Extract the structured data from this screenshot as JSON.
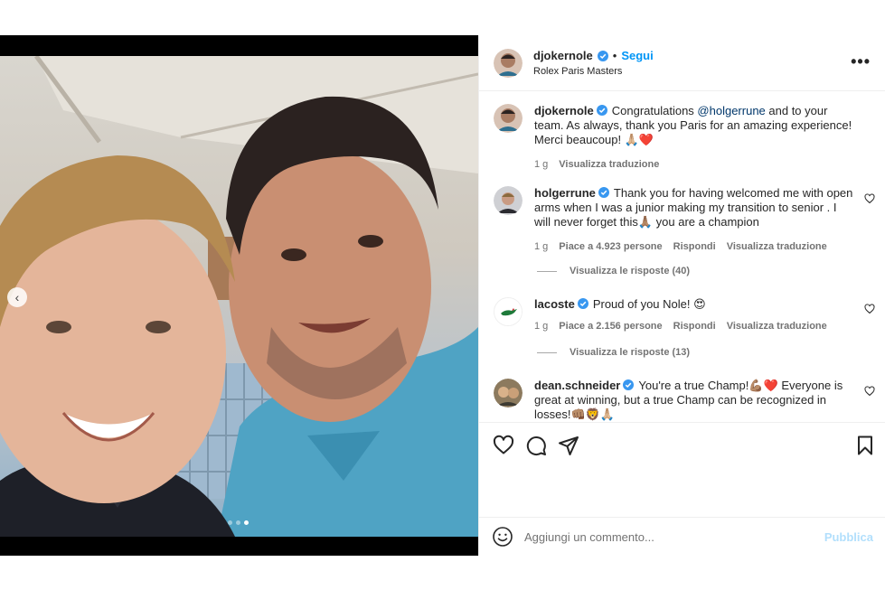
{
  "post": {
    "author": "djokernole",
    "bullet": "•",
    "follow_label": "Segui",
    "location": "Rolex Paris Masters",
    "more_label": "•••",
    "carousel": {
      "total": 3,
      "active_index": 2
    }
  },
  "comments": [
    {
      "user": "djokernole",
      "verified": true,
      "text_before": "Congratulations ",
      "mention": "@holgerrune",
      "text_after": " and to your team. As always, thank you Paris for an amazing experience! Merci beaucoup! 🙏🏼❤️",
      "time": "1 g",
      "translate": "Visualizza traduzione"
    },
    {
      "user": "holgerrune",
      "verified": true,
      "text": "Thank you for having welcomed me with open arms when I was a junior making my transition to senior . I will never forget this🙏🏽 you are a champion",
      "time": "1 g",
      "likes": "Piace a 4.923 persone",
      "reply": "Rispondi",
      "translate": "Visualizza traduzione",
      "replies_label": "Visualizza le risposte (40)"
    },
    {
      "user": "lacoste",
      "verified": true,
      "text": "Proud of you Nole! 😍",
      "time": "1 g",
      "likes": "Piace a 2.156 persone",
      "reply": "Rispondi",
      "translate": "Visualizza traduzione",
      "replies_label": "Visualizza le risposte (13)"
    },
    {
      "user": "dean.schneider",
      "verified": true,
      "text": "You're a true Champ!💪🏽❤️ Everyone is great at winning, but a true Champ can be recognized in losses!👊🏽🦁🙏🏼"
    }
  ],
  "composer": {
    "placeholder": "Aggiungi un commento...",
    "publish_label": "Pubblica"
  },
  "colors": {
    "accent": "#0095f6",
    "verified": "#3897f0",
    "publish_disabled": "#b2dffc",
    "heart": "#ed4956"
  },
  "icons": [
    "chevron-left-icon",
    "verified-badge-icon",
    "more-icon",
    "heart-icon",
    "comment-icon",
    "share-icon",
    "bookmark-icon",
    "emoji-icon"
  ]
}
